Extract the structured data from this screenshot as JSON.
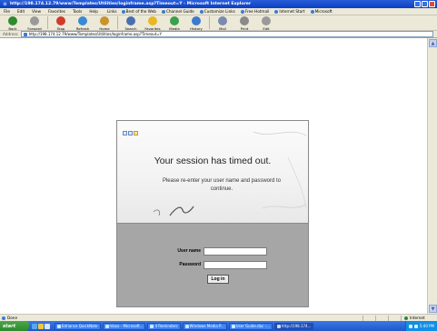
{
  "window": {
    "title": "http://198.174.12.79/www/Templates/Utilities/loginframe.asp?Timeout=Y - Microsoft Internet Explorer"
  },
  "menu": [
    "File",
    "Edit",
    "View",
    "Favorites",
    "Tools",
    "Help"
  ],
  "links_label": "Links",
  "links": [
    "Best of the Web",
    "Channel Guide",
    "Customize Links",
    "Free Hotmail",
    "Internet Start",
    "Microsoft"
  ],
  "toolbar": [
    {
      "label": "Back",
      "icon": "back-icon",
      "color": "#2e8b2e"
    },
    {
      "label": "Forward",
      "icon": "forward-icon",
      "color": "#9a9a9a"
    },
    {
      "label": "Stop",
      "icon": "stop-icon",
      "color": "#d23a2a"
    },
    {
      "label": "Refresh",
      "icon": "refresh-icon",
      "color": "#3a8ad6"
    },
    {
      "label": "Home",
      "icon": "home-icon",
      "color": "#c8942c"
    },
    {
      "label": "Search",
      "icon": "search-icon",
      "color": "#4a6fb0"
    },
    {
      "label": "Favorites",
      "icon": "favorites-icon",
      "color": "#e8b820"
    },
    {
      "label": "Media",
      "icon": "media-icon",
      "color": "#3aa04a"
    },
    {
      "label": "History",
      "icon": "history-icon",
      "color": "#3a7ad0"
    },
    {
      "label": "Mail",
      "icon": "mail-icon",
      "color": "#7a8ab0"
    },
    {
      "label": "Print",
      "icon": "print-icon",
      "color": "#8a8a8a"
    },
    {
      "label": "Edit",
      "icon": "edit-icon",
      "color": "#9a9a9a"
    }
  ],
  "address": {
    "label": "Address",
    "url": "http://198.174.12.79/www/Templates/Utilities/loginframe.asp?Timeout=Y"
  },
  "login": {
    "headline": "Your session has timed out.",
    "message": "Please re-enter your user name and password to continue.",
    "username_label": "User name",
    "password_label": "Password",
    "username_value": "",
    "password_value": "",
    "button_label": "Log in"
  },
  "status": {
    "text": "Done",
    "zone": "Internet"
  },
  "taskbar": {
    "start_label": "start",
    "tasks": [
      {
        "label": "Edriance QuickNote",
        "active": false
      },
      {
        "label": "Inbox - Microsoft...",
        "active": false
      },
      {
        "label": "4 Reminders",
        "active": false
      },
      {
        "label": "Windows Media P...",
        "active": false
      },
      {
        "label": "User Guide.doc -...",
        "active": false
      },
      {
        "label": "http://198.174...",
        "active": true
      }
    ],
    "clock": "5:40 PM"
  },
  "colors": {
    "titlebar": "#0a3fc0",
    "form_panel": "#a6a6a6",
    "taskbar": "#2058c8",
    "start_button": "#2c8a2c"
  }
}
